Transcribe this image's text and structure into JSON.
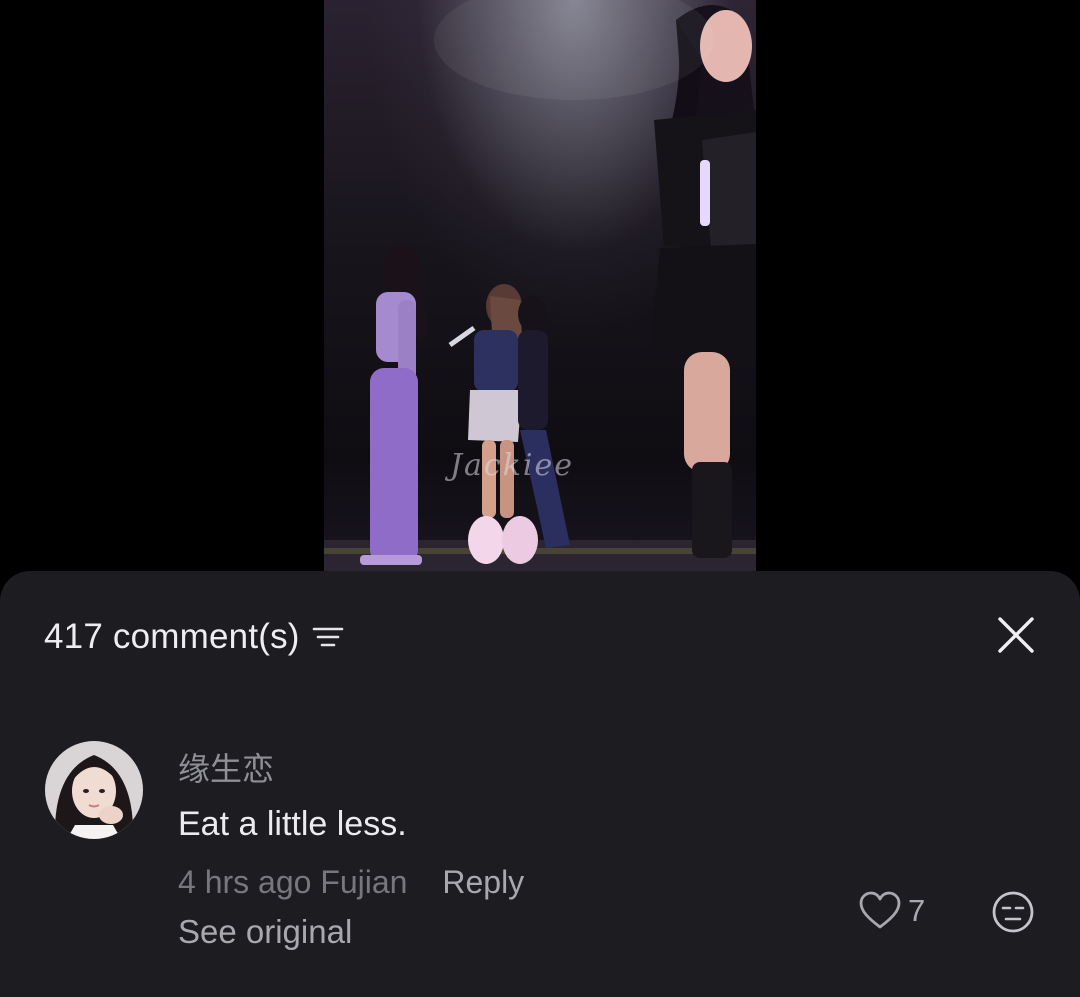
{
  "video": {
    "watermark": "Jackiee"
  },
  "comments_sheet": {
    "count_label": "417 comment(s)",
    "icons": {
      "filter": "filter-lines-icon",
      "close": "close-icon"
    },
    "comments": [
      {
        "username": "缘生恋",
        "text": "Eat a little less.",
        "time": "4 hrs ago",
        "location": "Fujian",
        "reply_label": "Reply",
        "see_original_label": "See original",
        "likes": "7",
        "like_icon": "heart-outline-icon",
        "reaction_icon": "emoji-face-icon"
      }
    ]
  },
  "colors": {
    "sheet_bg": "#1c1c21",
    "primary_text": "#ececef",
    "secondary_text": "#8f8f96",
    "tertiary_text": "#77777e"
  }
}
